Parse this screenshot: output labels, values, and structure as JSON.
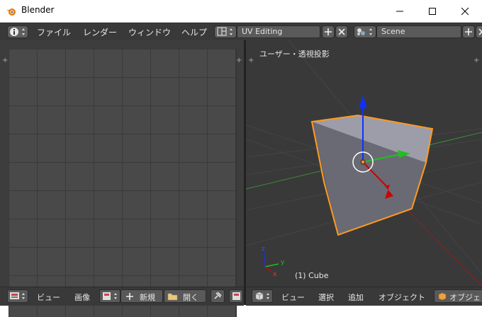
{
  "window": {
    "title": "Blender"
  },
  "menus": [
    "ファイル",
    "レンダー",
    "ウィンドウ",
    "ヘルプ"
  ],
  "screen_layout": {
    "value": "UV Editing"
  },
  "scene": {
    "value": "Scene"
  },
  "viewport": {
    "view_label": "ユーザー・透視投影",
    "object_label": "(1) Cube"
  },
  "uv_footer": {
    "view": "ビュー",
    "image": "画像",
    "new": "新規",
    "open": "開く"
  },
  "view3d_footer": {
    "view": "ビュー",
    "select": "選択",
    "add": "追加",
    "object": "オブジェクト",
    "mode": "オブジェ"
  },
  "colors": {
    "selection_outline": "#ff9a1f",
    "x_axis": "#d00000",
    "y_axis": "#20c020",
    "z_axis": "#1030ff"
  }
}
